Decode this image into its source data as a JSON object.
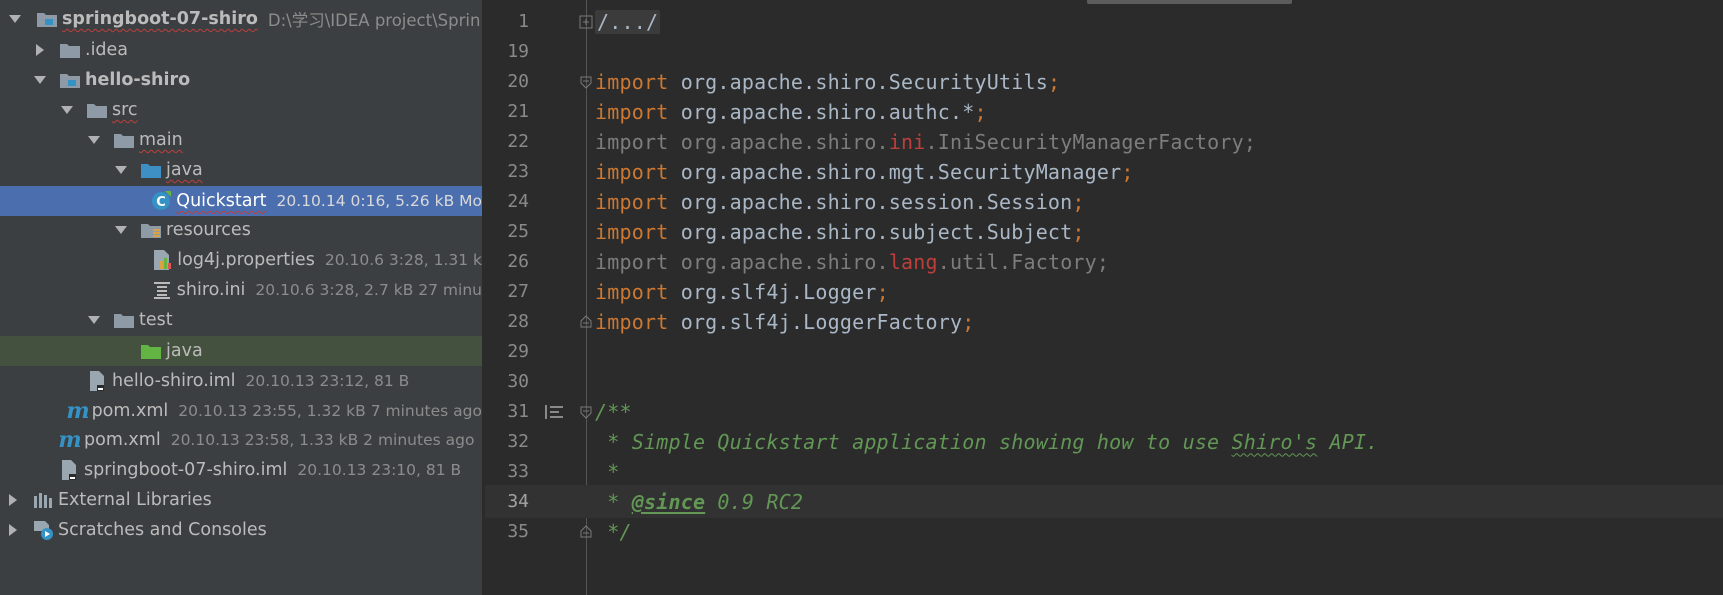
{
  "project_tree": {
    "root": {
      "label": "springboot-07-shiro",
      "path": "D:\\学习\\IDEA project\\Sprin"
    },
    "items": [
      {
        "label": ".idea",
        "meta": ""
      },
      {
        "label": "hello-shiro",
        "meta": ""
      },
      {
        "label": "src",
        "meta": ""
      },
      {
        "label": "main",
        "meta": ""
      },
      {
        "label": "java",
        "meta": ""
      },
      {
        "label": "Quickstart",
        "meta": "20.10.14 0:16, 5.26 kB Mo"
      },
      {
        "label": "resources",
        "meta": ""
      },
      {
        "label": "log4j.properties",
        "meta": "20.10.6 3:28, 1.31 k"
      },
      {
        "label": "shiro.ini",
        "meta": "20.10.6 3:28, 2.7 kB 27 minu"
      },
      {
        "label": "test",
        "meta": ""
      },
      {
        "label": "java",
        "meta": ""
      },
      {
        "label": "hello-shiro.iml",
        "meta": "20.10.13 23:12, 81 B"
      },
      {
        "label": "pom.xml",
        "meta": "20.10.13 23:55, 1.32 kB 7 minutes ago"
      },
      {
        "label": "pom.xml",
        "meta": "20.10.13 23:58, 1.33 kB 2 minutes ago"
      },
      {
        "label": "springboot-07-shiro.iml",
        "meta": "20.10.13 23:10, 81 B"
      },
      {
        "label": "External Libraries",
        "meta": ""
      },
      {
        "label": "Scratches and Consoles",
        "meta": ""
      }
    ]
  },
  "editor": {
    "current_line": "34",
    "lines": [
      {
        "num": "1",
        "folded": "/.../"
      },
      {
        "num": "19"
      },
      {
        "num": "20",
        "kw": "import",
        "pkg": "org.apache.shiro.SecurityUtils",
        "semi": ";"
      },
      {
        "num": "21",
        "kw": "import",
        "pkg": "org.apache.shiro.authc.*",
        "semi": ";"
      },
      {
        "num": "22",
        "kw": "import",
        "pre": "org.apache.shiro.",
        "err": "ini",
        "post": ".IniSecurityManagerFactory;"
      },
      {
        "num": "23",
        "kw": "import",
        "pkg": "org.apache.shiro.mgt.SecurityManager",
        "semi": ";"
      },
      {
        "num": "24",
        "kw": "import",
        "pkg": "org.apache.shiro.session.Session",
        "semi": ";"
      },
      {
        "num": "25",
        "kw": "import",
        "pkg": "org.apache.shiro.subject.Subject",
        "semi": ";"
      },
      {
        "num": "26",
        "kw": "import",
        "pre": "org.apache.shiro.",
        "err": "lang",
        "post": ".util.Factory;"
      },
      {
        "num": "27",
        "kw": "import",
        "pkg": "org.slf4j.Logger",
        "semi": ";"
      },
      {
        "num": "28",
        "kw": "import",
        "pkg": "org.slf4j.LoggerFactory",
        "semi": ";"
      },
      {
        "num": "29"
      },
      {
        "num": "30"
      },
      {
        "num": "31",
        "text": "/**"
      },
      {
        "num": "32",
        "star": " * ",
        "a": "Simple Quickstart application showing how to use ",
        "wavy": "Shiro's",
        "b": " API."
      },
      {
        "num": "33",
        "text": " *"
      },
      {
        "num": "34",
        "star": " * ",
        "tag": "@since",
        "b": " 0.9 RC2"
      },
      {
        "num": "35",
        "text": " */"
      }
    ]
  }
}
